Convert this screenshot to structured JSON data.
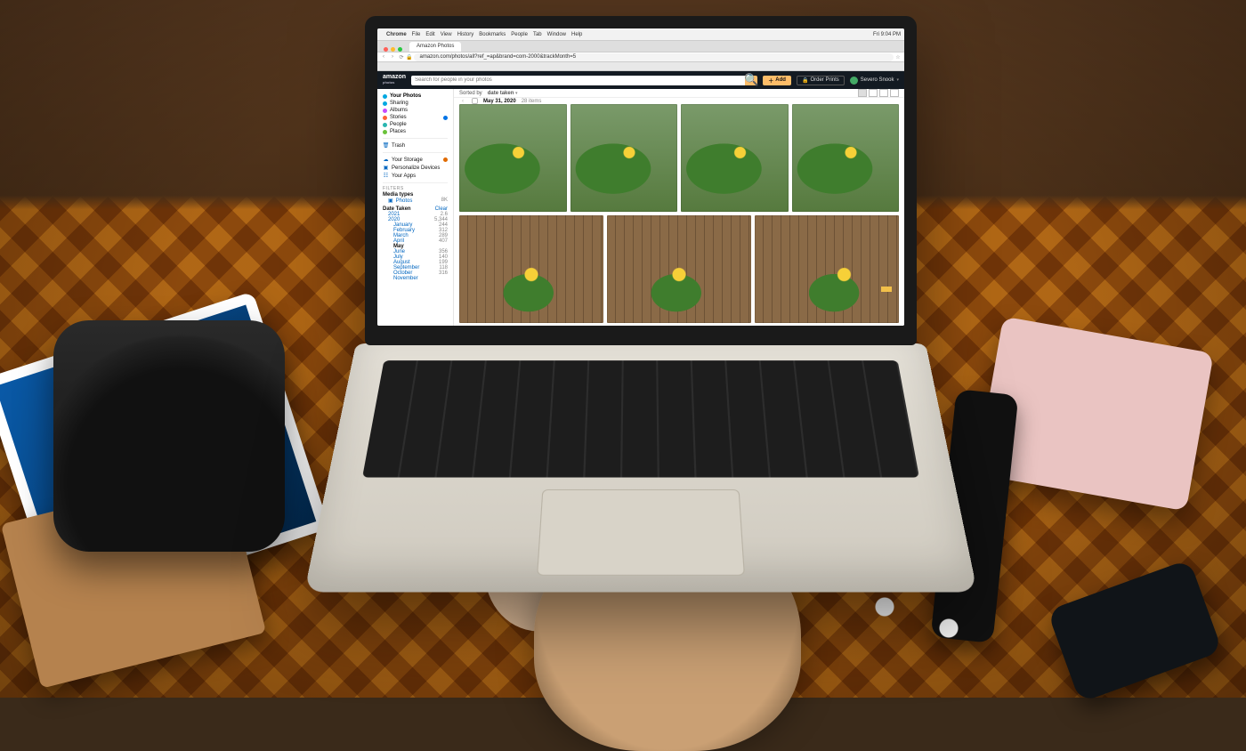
{
  "macos": {
    "apple": "",
    "app": "Chrome",
    "menus": [
      "File",
      "Edit",
      "View",
      "History",
      "Bookmarks",
      "People",
      "Tab",
      "Window",
      "Help"
    ],
    "right": [
      "🔋",
      "📶",
      "🔍",
      "Fri 9:04 PM"
    ]
  },
  "browser": {
    "tab_title": "Amazon Photos",
    "url": "amazon.com/photos/all?ref_=ap&brand=com-2000&trackMonth=5",
    "traffic": {
      "close": "#ff5f57",
      "min": "#febc2e",
      "max": "#28c840"
    }
  },
  "header": {
    "brand_top": "amazon",
    "brand_bottom": "photos",
    "search_placeholder": "Search for people in your photos",
    "add_label": "Add",
    "order_prints_label": "Order Prints",
    "account_name": "Severo Snook"
  },
  "sidebar": {
    "nav": [
      {
        "label": "Your Photos",
        "color": "#00a8e1",
        "active": true
      },
      {
        "label": "Sharing",
        "color": "#00a8e1"
      },
      {
        "label": "Albums",
        "color": "#c64bff"
      },
      {
        "label": "Stories",
        "color": "#ff6138",
        "badge": true
      },
      {
        "label": "People",
        "color": "#2ab5b0"
      },
      {
        "label": "Places",
        "color": "#6ac23a"
      }
    ],
    "trash_label": "Trash",
    "storage_label": "Your Storage",
    "storage_warn": true,
    "personalize_label": "Personalize Devices",
    "apps_label": "Your Apps",
    "filters_heading": "FILTERS",
    "media_heading": "Media types",
    "media_photos": "Photos",
    "media_photos_count": "8K",
    "date_heading": "Date Taken",
    "clear_label": "Clear",
    "years": [
      {
        "label": "2021",
        "count": "2.6"
      },
      {
        "label": "2020",
        "count": "5,344",
        "expanded": true,
        "months": [
          {
            "label": "January",
            "count": "244"
          },
          {
            "label": "February",
            "count": "312"
          },
          {
            "label": "March",
            "count": "289"
          },
          {
            "label": "April",
            "count": "407"
          },
          {
            "label": "May",
            "count": "",
            "selected": true
          },
          {
            "label": "June",
            "count": "356"
          },
          {
            "label": "July",
            "count": "140"
          },
          {
            "label": "August",
            "count": "199"
          },
          {
            "label": "September",
            "count": "118"
          },
          {
            "label": "October",
            "count": "316"
          },
          {
            "label": "November",
            "count": ""
          }
        ]
      }
    ]
  },
  "content": {
    "sort_prefix": "Sorted by",
    "sort_value": "date taken",
    "date_header": "May 31, 2020",
    "date_count": "28 items"
  }
}
